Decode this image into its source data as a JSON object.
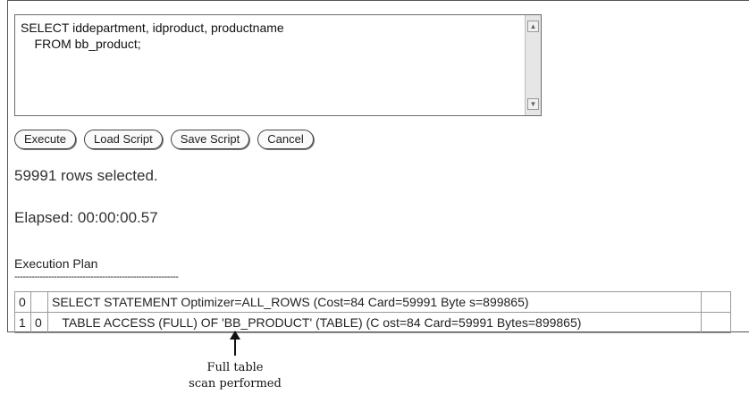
{
  "editor": {
    "sql_line1": "SELECT iddepartment, idproduct, productname",
    "sql_line2": "    FROM bb_product;"
  },
  "buttons": {
    "execute": "Execute",
    "load_script": "Load Script",
    "save_script": "Save Script",
    "cancel": "Cancel"
  },
  "results": {
    "rows_selected": "59991 rows selected.",
    "elapsed": "Elapsed: 00:00:00.57"
  },
  "plan": {
    "title": "Execution Plan",
    "separator": "----------------------------------------------------------",
    "rows": [
      {
        "c0": "0",
        "c1": "",
        "text": "SELECT STATEMENT Optimizer=ALL_ROWS (Cost=84 Card=59991 Byte s=899865)"
      },
      {
        "c0": "1",
        "c1": "0",
        "text": "   TABLE ACCESS (FULL) OF 'BB_PRODUCT' (TABLE) (C ost=84 Card=59991 Bytes=899865)"
      }
    ]
  },
  "annotation": {
    "line1": "Full table",
    "line2": "scan performed"
  }
}
